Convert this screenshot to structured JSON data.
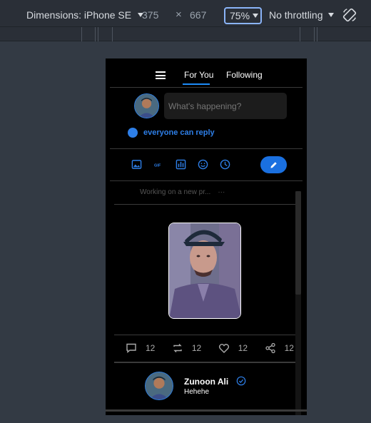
{
  "devtools": {
    "device_label": "Dimensions: iPhone SE",
    "width": "375",
    "times": "×",
    "height": "667",
    "zoom": "75%",
    "throttle": "No throttling",
    "rotate_icon": "rotate-icon"
  },
  "app": {
    "menu_icon": "hamburger-icon",
    "tabs": [
      {
        "label": "For You",
        "active": true
      },
      {
        "label": "Following",
        "active": false
      }
    ],
    "compose": {
      "placeholder": "What's happening?",
      "reply_setting": "everyone can reply",
      "tools": [
        "image-icon",
        "gif-icon",
        "poll-icon",
        "emoji-icon",
        "schedule-icon"
      ],
      "post_icon": "pencil-icon"
    },
    "feed": {
      "faded_text": "Working on a new pr...",
      "faded_more": "···",
      "actions": [
        {
          "icon": "comment-icon",
          "count": "12"
        },
        {
          "icon": "retweet-icon",
          "count": "12"
        },
        {
          "icon": "heart-icon",
          "count": "12"
        },
        {
          "icon": "share-icon",
          "count": "12"
        }
      ],
      "next_post": {
        "author": "Zunoon Ali",
        "text": "Hehehe",
        "verified_icon": "verified-icon"
      }
    },
    "accent": "#1d8cf8"
  }
}
